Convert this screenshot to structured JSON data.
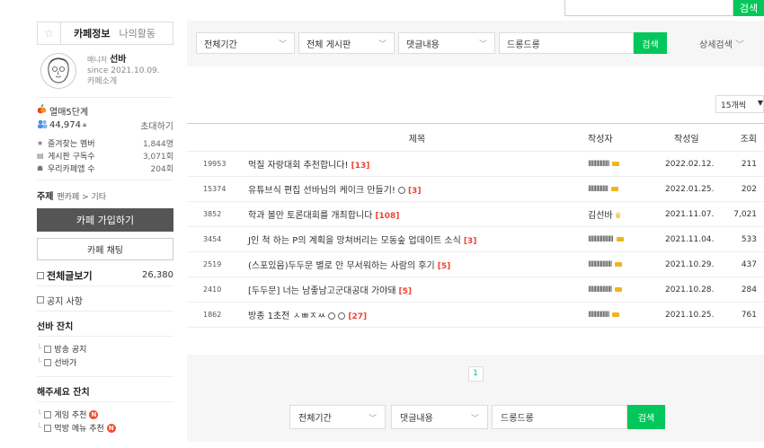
{
  "top_search": {
    "button": "검색"
  },
  "sidebar": {
    "tab_info": "카페정보",
    "tab_activity": "나의활동",
    "manager_role": "매니저",
    "manager_name": "선바",
    "since": "since 2021.10.09.",
    "intro_link": "카페소개",
    "level": "열매5단계",
    "members": "44,974",
    "invite": "초대하기",
    "stats": [
      {
        "label": "즐겨찾는 멤버",
        "value": "1,844명"
      },
      {
        "label": "게시판 구독수",
        "value": "3,071회"
      },
      {
        "label": "우리카페앱 수",
        "value": "204회"
      }
    ],
    "topic_label": "주제",
    "topic_value": "팬카페 > 기타",
    "join_button": "카페 가입하기",
    "chat_button": "카페 채팅",
    "all_posts_label": "전체글보기",
    "all_posts_count": "26,380",
    "notice": "공지 사항",
    "section1": "선바 잔치",
    "section1_items": [
      "방송 공지",
      "선바가"
    ],
    "section2": "해주세요 잔치",
    "section2_items": [
      "게임 추천",
      "먹방 메뉴 추천"
    ],
    "new_badge": "N"
  },
  "filter": {
    "period": "전체기간",
    "board": "전체 게시판",
    "field": "댓글내용",
    "query": "드롱드롱",
    "search_button": "검색",
    "advanced": "상세검색"
  },
  "per_page": "15개씩",
  "table": {
    "headers": {
      "title": "제목",
      "author": "작성자",
      "date": "작성일",
      "views": "조회"
    },
    "rows": [
      {
        "num": "19953",
        "title": "먹질 자랑대회 추천합니다!",
        "comments": "[13]",
        "author": "IIIIIIIIIIIIIIII",
        "date": "2022.02.12.",
        "views": "211"
      },
      {
        "num": "15374",
        "title": "유튜브식 편집 선바님의 케이크 만들기!",
        "comments": "[3]",
        "author": "IIIIIIIIIIIIIII",
        "date": "2022.01.25.",
        "views": "202"
      },
      {
        "num": "3852",
        "title": "학과 볼만 토론대회를 개최합니다",
        "comments": "[108]",
        "author": "김선바",
        "date": "2021.11.07.",
        "views": "7,021"
      },
      {
        "num": "3454",
        "title": "J인 척 하는 P의 계획을 망쳐버리는 모동숲 업데이트 소식",
        "comments": "[3]",
        "author": "IIIIIIIIIIIIIIIIIII",
        "date": "2021.11.04.",
        "views": "533"
      },
      {
        "num": "2519",
        "title": "(스포있음)두두문 별로 안 무서워하는 사람의 후기",
        "comments": "[5]",
        "author": "IIIIIIIIIIIIIIIIII",
        "date": "2021.10.29.",
        "views": "437"
      },
      {
        "num": "2410",
        "title": "[두두문] 너는 남좋남고군대공대 가야돼",
        "comments": "[5]",
        "author": "IIIIIIIIIIIIIIIIII",
        "date": "2021.10.28.",
        "views": "284"
      },
      {
        "num": "1862",
        "title": "방종 1초전 ㅅㅃㅈㅆ",
        "comments": "[27]",
        "author": "IIIIIIIIIIIIIIII",
        "date": "2021.10.25.",
        "views": "761"
      }
    ]
  },
  "pager": {
    "current": "1"
  },
  "bottom": {
    "period": "전체기간",
    "field": "댓글내용",
    "query": "드롱드롱",
    "search_button": "검색"
  }
}
